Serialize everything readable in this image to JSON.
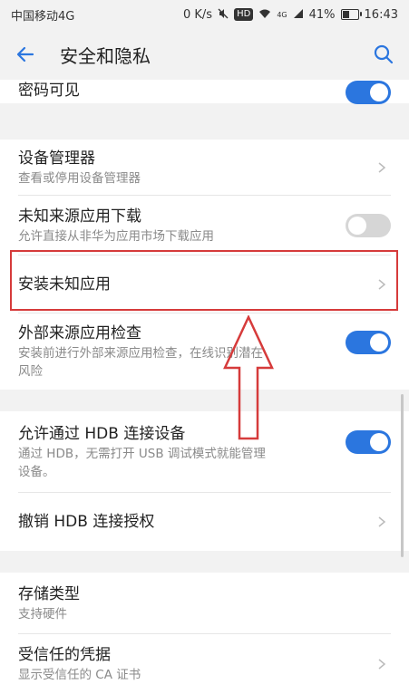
{
  "status_bar": {
    "carrier": "中国移动4G",
    "speed": "0 K/s",
    "hd": "HD",
    "network": "4G",
    "battery": "41%",
    "time": "16:43"
  },
  "app_bar": {
    "title": "安全和隐私"
  },
  "rows": {
    "password_visible": {
      "title": "密码可见",
      "toggle": "on"
    },
    "device_manager": {
      "title": "设备管理器",
      "sub": "查看或停用设备管理器"
    },
    "unknown_sources": {
      "title": "未知来源应用下载",
      "sub": "允许直接从非华为应用市场下载应用",
      "toggle": "off"
    },
    "install_unknown": {
      "title": "安装未知应用"
    },
    "external_check": {
      "title": "外部来源应用检查",
      "sub1": "安装前进行外部来源应用检查，在线识别潜在",
      "sub2": "风险",
      "toggle": "on"
    },
    "hdb": {
      "title": "允许通过 HDB 连接设备",
      "sub1": "通过 HDB，无需打开 USB 调试模式就能管理",
      "sub2": "设备。",
      "toggle": "on"
    },
    "revoke_hdb": {
      "title": "撤销 HDB 连接授权"
    },
    "storage_type": {
      "title": "存储类型",
      "sub": "支持硬件"
    },
    "trusted_cert": {
      "title": "受信任的凭据",
      "sub": "显示受信任的 CA 证书"
    }
  },
  "colors": {
    "accent": "#2b76df",
    "annotation": "#d63b3b"
  }
}
